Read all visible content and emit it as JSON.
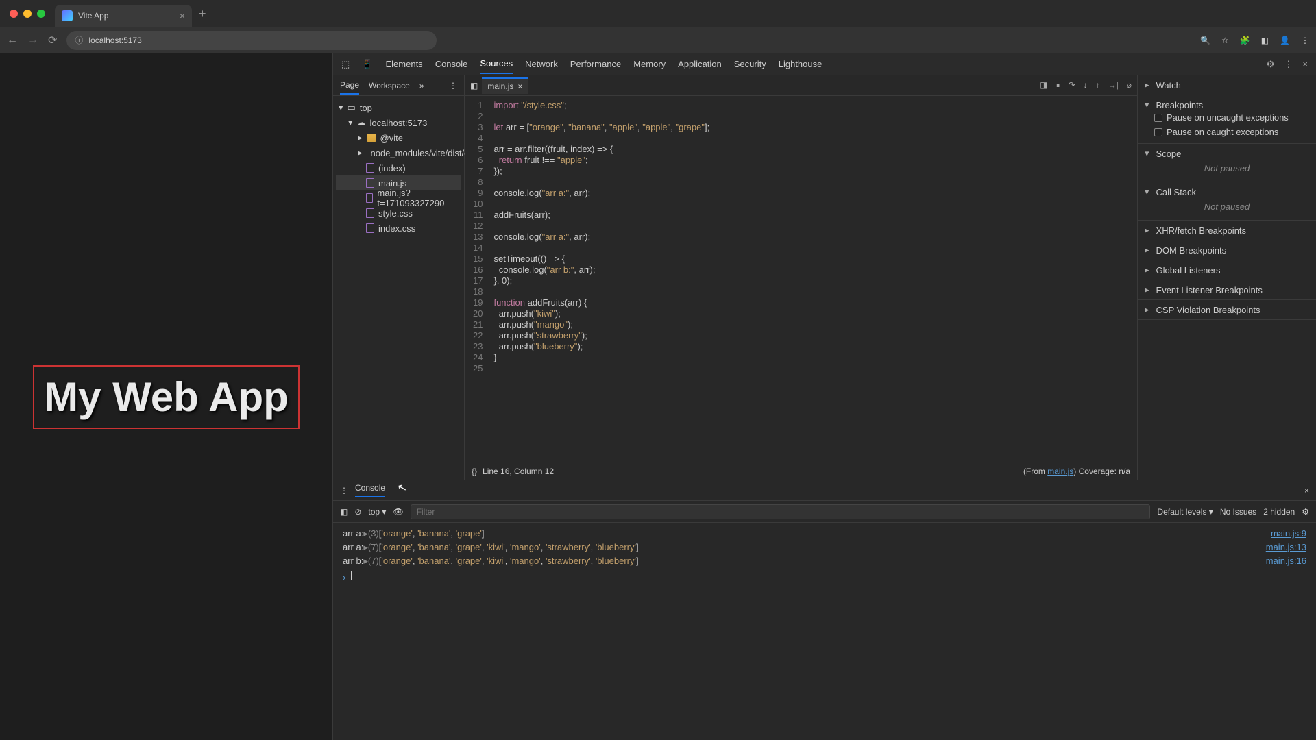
{
  "browser": {
    "tab_title": "Vite App",
    "url": "localhost:5173",
    "traffic_colors": [
      "#ff5f57",
      "#febc2e",
      "#28c840"
    ]
  },
  "page": {
    "heading": "My Web App"
  },
  "devtools": {
    "tabs": [
      "Elements",
      "Console",
      "Sources",
      "Network",
      "Performance",
      "Memory",
      "Application",
      "Security",
      "Lighthouse"
    ],
    "active_tab": "Sources",
    "nav_tabs": [
      "Page",
      "Workspace"
    ],
    "tree": {
      "top": "top",
      "origin": "localhost:5173",
      "folder1": "@vite",
      "folder2": "node_modules/vite/dist/c",
      "file_index": "(index)",
      "file_main": "main.js",
      "file_mainjs_q": "main.js?t=171093327290",
      "file_style": "style.css",
      "file_indexcss": "index.css"
    },
    "editor_tab": "main.js",
    "status_left": "Line 16, Column 12",
    "status_from": "(From ",
    "status_from_link": "main.js",
    "status_coverage": ") Coverage: n/a",
    "right": {
      "watch": "Watch",
      "breakpoints": "Breakpoints",
      "pause_uncaught": "Pause on uncaught exceptions",
      "pause_caught": "Pause on caught exceptions",
      "scope": "Scope",
      "not_paused": "Not paused",
      "call_stack": "Call Stack",
      "xhr": "XHR/fetch Breakpoints",
      "dom": "DOM Breakpoints",
      "global": "Global Listeners",
      "evt": "Event Listener Breakpoints",
      "csp": "CSP Violation Breakpoints"
    },
    "code_lines": [
      "import \"/style.css\";",
      "",
      "let arr = [\"orange\", \"banana\", \"apple\", \"apple\", \"grape\"];",
      "",
      "arr = arr.filter((fruit, index) => {",
      "  return fruit !== \"apple\";",
      "});",
      "",
      "console.log(\"arr a:\", arr);",
      "",
      "addFruits(arr);",
      "",
      "console.log(\"arr a:\", arr);",
      "",
      "setTimeout(() => {",
      "  console.log(\"arr b:\", arr);",
      "}, 0);",
      "",
      "function addFruits(arr) {",
      "  arr.push(\"kiwi\");",
      "  arr.push(\"mango\");",
      "  arr.push(\"strawberry\");",
      "  arr.push(\"blueberry\");",
      "}",
      ""
    ]
  },
  "drawer": {
    "title": "Console",
    "context": "top",
    "filter_ph": "Filter",
    "levels": "Default levels",
    "no_issues": "No Issues",
    "hidden": "2 hidden",
    "logs": [
      {
        "label": "arr a:",
        "count": 3,
        "items": [
          "orange",
          "banana",
          "grape"
        ],
        "src": "main.js:9"
      },
      {
        "label": "arr a:",
        "count": 7,
        "items": [
          "orange",
          "banana",
          "grape",
          "kiwi",
          "mango",
          "strawberry",
          "blueberry"
        ],
        "src": "main.js:13"
      },
      {
        "label": "arr b:",
        "count": 7,
        "items": [
          "orange",
          "banana",
          "grape",
          "kiwi",
          "mango",
          "strawberry",
          "blueberry"
        ],
        "src": "main.js:16"
      }
    ]
  }
}
